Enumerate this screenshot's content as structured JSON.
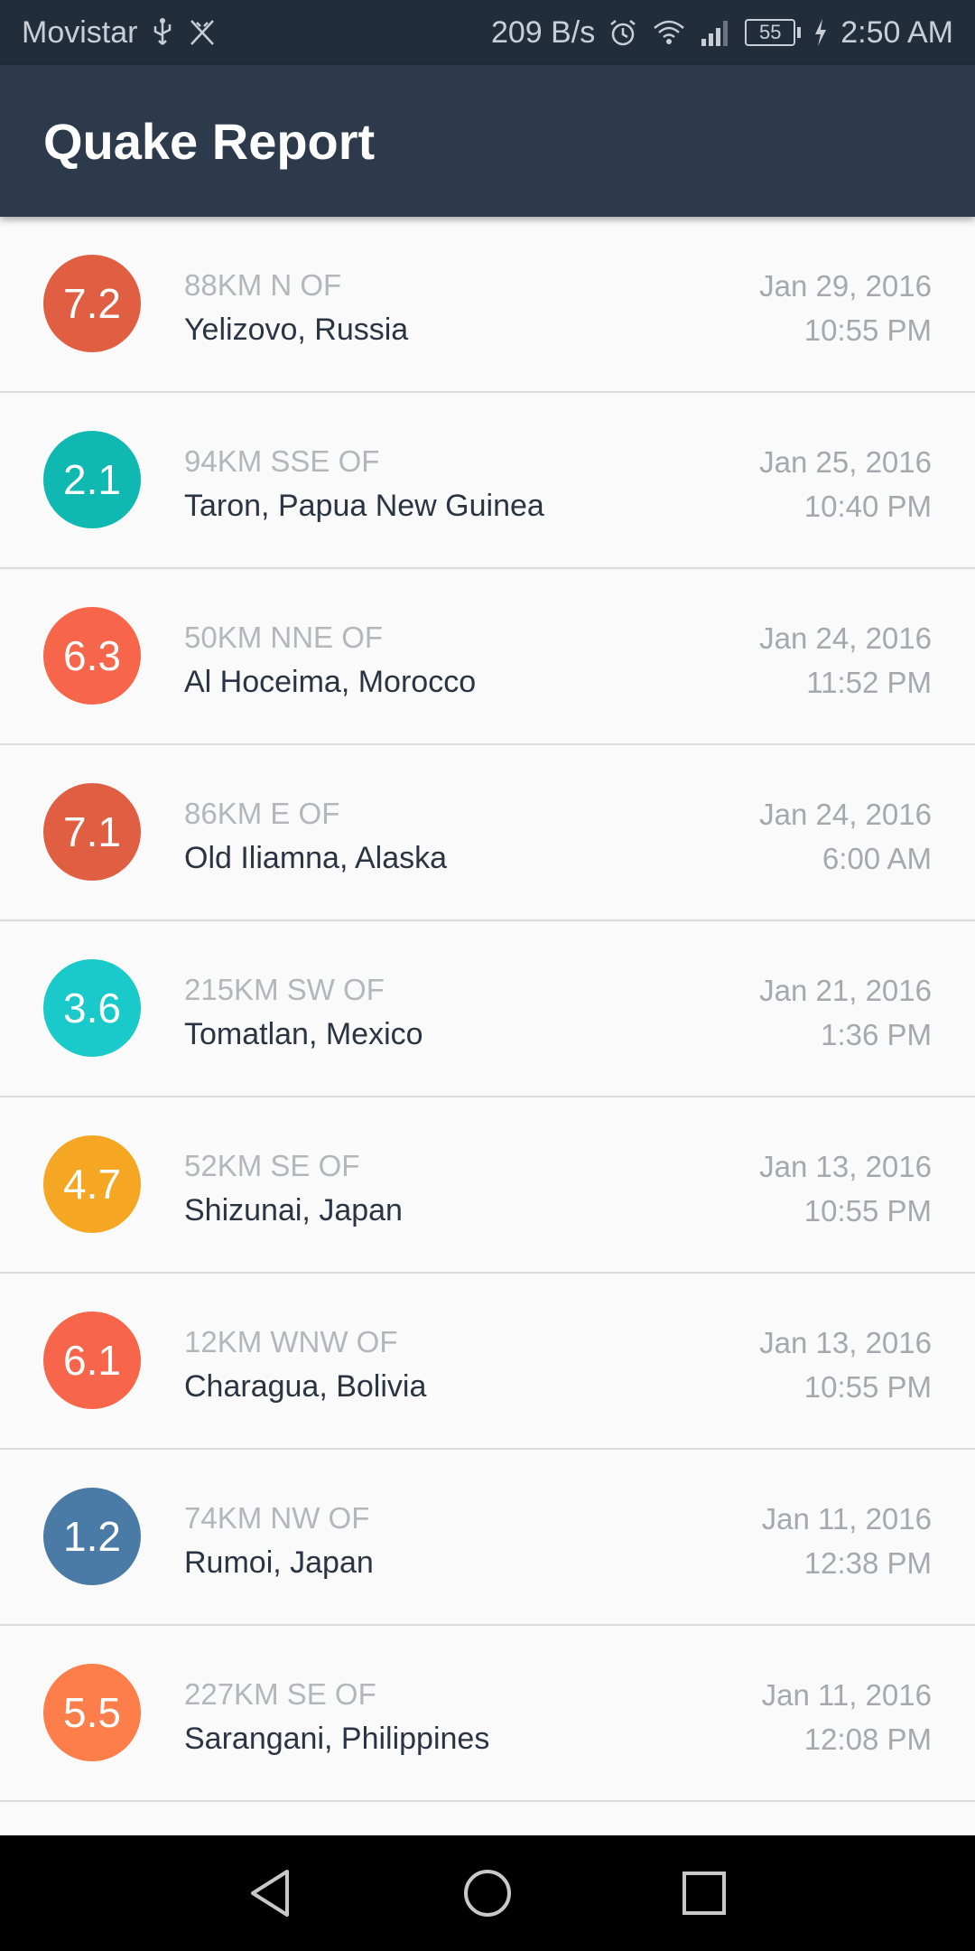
{
  "status_bar": {
    "carrier": "Movistar",
    "net_speed": "209 B/s",
    "battery": "55",
    "time": "2:50 AM"
  },
  "app": {
    "title": "Quake Report"
  },
  "colors": {
    "status_bar_bg": "#222d3b",
    "app_bar_bg": "#2c3a4b",
    "list_bg": "#fafafa"
  },
  "quakes": [
    {
      "mag": "7.2",
      "offset": "88KM N OF",
      "primary": "Yelizovo, Russia",
      "date": "Jan 29, 2016",
      "time": "10:55 PM",
      "color": "#e05f43"
    },
    {
      "mag": "2.1",
      "offset": "94KM SSE OF",
      "primary": "Taron, Papua New Guinea",
      "date": "Jan 25, 2016",
      "time": "10:40 PM",
      "color": "#0fb8b1"
    },
    {
      "mag": "6.3",
      "offset": "50KM NNE OF",
      "primary": "Al Hoceima, Morocco",
      "date": "Jan 24, 2016",
      "time": "11:52 PM",
      "color": "#f7664a"
    },
    {
      "mag": "7.1",
      "offset": "86KM E OF",
      "primary": "Old Iliamna, Alaska",
      "date": "Jan 24, 2016",
      "time": "6:00 AM",
      "color": "#e05f43"
    },
    {
      "mag": "3.6",
      "offset": "215KM SW OF",
      "primary": "Tomatlan, Mexico",
      "date": "Jan 21, 2016",
      "time": "1:36 PM",
      "color": "#1ac9c9"
    },
    {
      "mag": "4.7",
      "offset": "52KM SE OF",
      "primary": "Shizunai, Japan",
      "date": "Jan 13, 2016",
      "time": "10:55 PM",
      "color": "#f5a623"
    },
    {
      "mag": "6.1",
      "offset": "12KM WNW OF",
      "primary": "Charagua, Bolivia",
      "date": "Jan 13, 2016",
      "time": "10:55 PM",
      "color": "#f7664a"
    },
    {
      "mag": "1.2",
      "offset": "74KM NW OF",
      "primary": "Rumoi, Japan",
      "date": "Jan 11, 2016",
      "time": "12:38 PM",
      "color": "#4a7ba6"
    },
    {
      "mag": "5.5",
      "offset": "227KM SE OF",
      "primary": "Sarangani, Philippines",
      "date": "Jan 11, 2016",
      "time": "12:08 PM",
      "color": "#fd7d4b"
    }
  ],
  "nav": {
    "back_icon": "back-triangle-icon",
    "home_icon": "home-circle-icon",
    "recents_icon": "recents-square-icon"
  }
}
